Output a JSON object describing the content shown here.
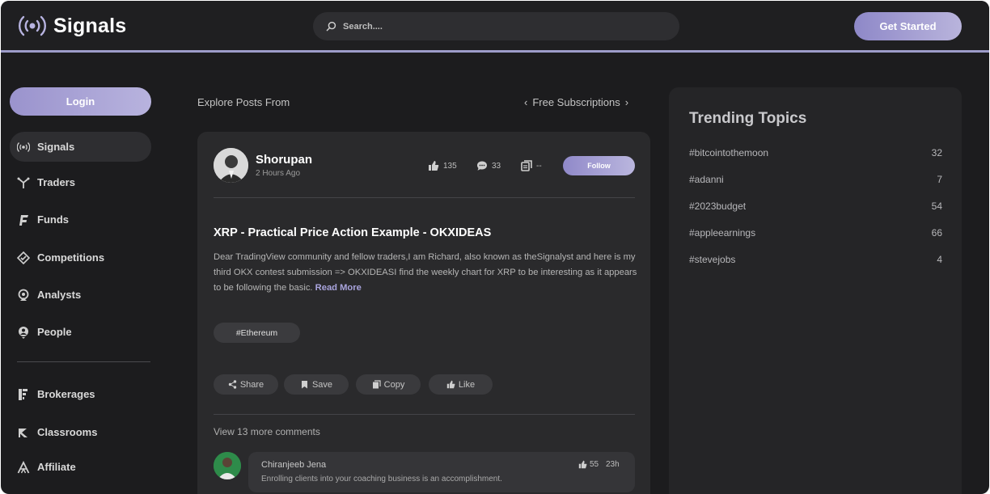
{
  "header": {
    "brand": "Signals",
    "search_placeholder": "Search....",
    "get_started": "Get Started"
  },
  "sidebar": {
    "login": "Login",
    "items": [
      {
        "label": "Signals",
        "icon": "broadcast-icon",
        "active": true
      },
      {
        "label": "Traders",
        "icon": "traders-icon"
      },
      {
        "label": "Funds",
        "icon": "funds-icon"
      },
      {
        "label": "Competitions",
        "icon": "competitions-icon"
      },
      {
        "label": "Analysts",
        "icon": "analysts-icon"
      },
      {
        "label": "People",
        "icon": "people-icon"
      },
      {
        "label": "Brokerages",
        "icon": "brokerages-icon"
      },
      {
        "label": "Classrooms",
        "icon": "classrooms-icon"
      },
      {
        "label": "Affiliate",
        "icon": "affiliate-icon"
      }
    ]
  },
  "feed": {
    "explore_label": "Explore Posts From",
    "subscriptions_label": "Free Subscriptions",
    "post": {
      "author": "Shorupan",
      "time": "2 Hours Ago",
      "likes": "135",
      "comments": "33",
      "copies": "--",
      "follow": "Follow",
      "title": "XRP - Practical Price Action Example - OKXIDEAS",
      "body": "Dear TradingView community and fellow traders,I am Richard, also known as theSignalyst and here is my third OKX contest submission => OKXIDEASI find the weekly chart for XRP to be interesting as it appears to be following the basic.",
      "read_more": "Read More",
      "tag": "#Ethereum",
      "actions": {
        "share": "Share",
        "save": "Save",
        "copy": "Copy",
        "like": "Like"
      },
      "view_more_comments": "View 13 more comments",
      "comment": {
        "name": "Chiranjeeb Jena",
        "text": "Enrolling clients into your coaching business is an accomplishment.",
        "likes": "55",
        "time": "23h"
      }
    }
  },
  "trending": {
    "title": "Trending Topics",
    "topics": [
      {
        "tag": "#bitcointothemoon",
        "count": "32"
      },
      {
        "tag": "#adanni",
        "count": "7"
      },
      {
        "tag": "#2023budget",
        "count": "54"
      },
      {
        "tag": "#appleearnings",
        "count": "66"
      },
      {
        "tag": "#stevejobs",
        "count": "4"
      }
    ]
  },
  "colors": {
    "accent": "#9d9cc9",
    "background": "#1c1c1e",
    "card": "#2a2a2c"
  }
}
